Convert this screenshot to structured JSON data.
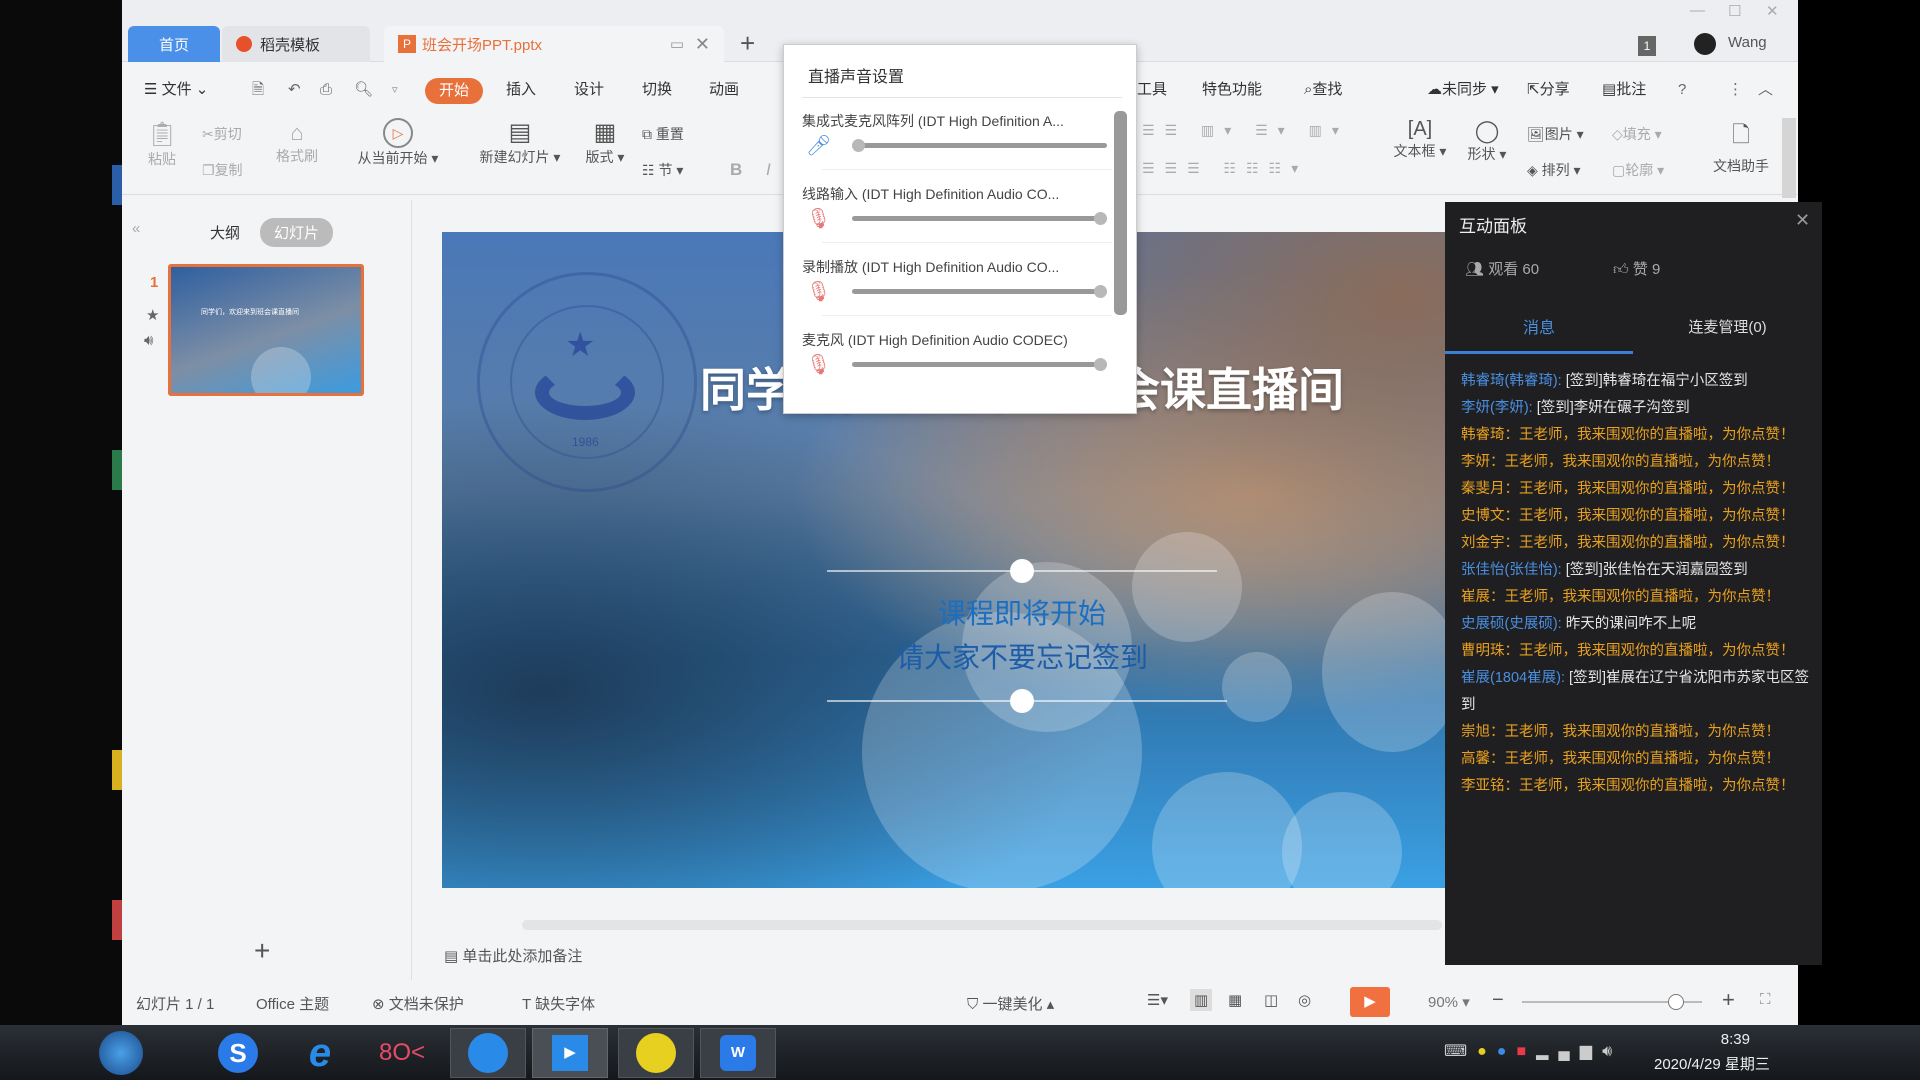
{
  "window": {
    "user": "Wang",
    "badge": "1"
  },
  "tabs": [
    {
      "label": "首页"
    },
    {
      "label": "稻壳模板"
    },
    {
      "label": "班会开场PPT.pptx"
    }
  ],
  "menu": {
    "file": "文件",
    "items": [
      "开始",
      "插入",
      "设计",
      "切换",
      "动画"
    ],
    "right": [
      "工具",
      "特色功能",
      "查找"
    ],
    "sync": "未同步",
    "share": "分享",
    "comment": "批注"
  },
  "ribbon": {
    "paste": "粘贴",
    "cut": "剪切",
    "copy": "复制",
    "format_painter": "格式刷",
    "play_from_current": "从当前开始",
    "new_slide": "新建幻灯片",
    "layout": "版式",
    "reset": "重置",
    "section": "节",
    "bold": "B",
    "italic": "I",
    "textbox": "文本框",
    "shape": "形状",
    "picture": "图片",
    "fill": "填充",
    "arrange": "排列",
    "outline": "轮廓",
    "doc_assistant": "文档助手"
  },
  "left_panel": {
    "outline_tab": "大纲",
    "slides_tab": "幻灯片",
    "slide_number": "1",
    "thumb_title": "同学们，欢迎来到班会课直播间"
  },
  "slide": {
    "title": "同学们，欢迎来到班会课直播间",
    "line1": "课程即将开始",
    "line2": "请大家不要忘记签到",
    "seal_text": "SHEN YANG STAR TECHNICAL SCHOOL",
    "seal_year": "1986"
  },
  "notes_placeholder": "单击此处添加备注",
  "audio_popup": {
    "title": "直播声音设置",
    "devices": [
      {
        "label": "集成式麦克风阵列 (IDT High Definition A...",
        "muted": false,
        "level": 0
      },
      {
        "label": "线路输入 (IDT High Definition Audio CO...",
        "muted": true,
        "level": 100
      },
      {
        "label": "录制播放 (IDT High Definition Audio CO...",
        "muted": true,
        "level": 100
      },
      {
        "label": "麦克风 (IDT High Definition Audio CODEC)",
        "muted": true,
        "level": 100
      }
    ]
  },
  "panel": {
    "title": "互动面板",
    "viewers_label": "观看 60",
    "likes_label": "赞 9",
    "tab_messages": "消息",
    "tab_mic": "连麦管理(0)",
    "messages": [
      {
        "name": "韩睿琦(韩睿琦):",
        "text": " [签到]韩睿琦在福宁小区签到",
        "type": "checkin"
      },
      {
        "name": "李妍(李妍):",
        "text": " [签到]李妍在碾子沟签到",
        "type": "checkin"
      },
      {
        "name": "韩睿琦：",
        "text": "王老师，我来围观你的直播啦，为你点赞！",
        "type": "like"
      },
      {
        "name": "李妍：",
        "text": "王老师，我来围观你的直播啦，为你点赞！",
        "type": "like"
      },
      {
        "name": "秦斐月：",
        "text": "王老师，我来围观你的直播啦，为你点赞！",
        "type": "like"
      },
      {
        "name": "史博文：",
        "text": "王老师，我来围观你的直播啦，为你点赞！",
        "type": "like"
      },
      {
        "name": "刘金宇：",
        "text": "王老师，我来围观你的直播啦，为你点赞！",
        "type": "like"
      },
      {
        "name": "张佳怡(张佳怡):",
        "text": " [签到]张佳怡在天润嘉园签到",
        "type": "checkin"
      },
      {
        "name": "崔展：",
        "text": "王老师，我来围观你的直播啦，为你点赞！",
        "type": "like"
      },
      {
        "name": "史展硕(史展硕):",
        "text": " 昨天的课间咋不上呢",
        "type": "checkin"
      },
      {
        "name": "曹明珠：",
        "text": "王老师，我来围观你的直播啦，为你点赞！",
        "type": "like"
      },
      {
        "name": "崔展(1804崔展):",
        "text": " [签到]崔展在辽宁省沈阳市苏家屯区签到",
        "type": "checkin"
      },
      {
        "name": "崇旭：",
        "text": "王老师，我来围观你的直播啦，为你点赞！",
        "type": "like"
      },
      {
        "name": "高馨：",
        "text": "王老师，我来围观你的直播啦，为你点赞！",
        "type": "like"
      },
      {
        "name": "李亚铭：",
        "text": "王老师，我来围观你的直播啦，为你点赞！",
        "type": "like"
      }
    ]
  },
  "status": {
    "slide_count": "幻灯片 1 / 1",
    "theme": "Office 主题",
    "protection": "文档未保护",
    "missing_font": "缺失字体",
    "beautify": "一键美化",
    "zoom": "90%",
    "zoom_level": 90
  },
  "taskbar": {
    "time": "8:39",
    "date": "2020/4/29 星期三"
  },
  "colors": {
    "accent": "#e8703a",
    "tab_home": "#4a8fe8",
    "panel_bg": "#1f1f22",
    "name_blue": "#4a8fe0",
    "msg_orange": "#e8a01e"
  }
}
